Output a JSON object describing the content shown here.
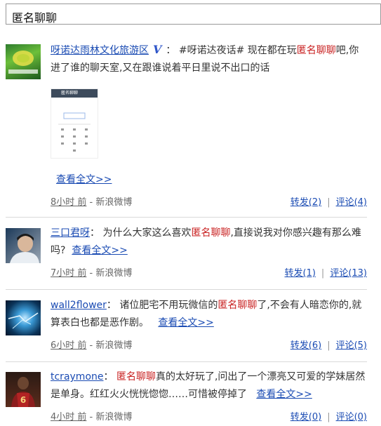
{
  "search": {
    "query": "匿名聊聊"
  },
  "posts": [
    {
      "author": "呀诺达雨林文化旅游区",
      "verified": "V",
      "colon": "：",
      "text_pre": "#呀诺达夜话# 现在都在玩",
      "keyword": "匿名聊聊",
      "text_post": "吧,你进了谁的聊天室,又在跟谁说着平日里说不出口的话",
      "read_more": "查看全文>>",
      "time": "8小时 前",
      "source": "- 新浪微博",
      "repost": "转发(2)",
      "comment": "评论(4)",
      "thumb_title": "匿名聊聊"
    },
    {
      "author": "三口君呀",
      "colon": "：",
      "text_pre": "为什么大家这么喜欢",
      "keyword": "匿名聊聊",
      "text_post": ",直接说我对你感兴趣有那么难吗?",
      "read_more": "查看全文>>",
      "time": "7小时 前",
      "source": "- 新浪微博",
      "repost": "转发(1)",
      "comment": "评论(13)"
    },
    {
      "author": "wall2flower",
      "colon": "：",
      "text_pre": "诸位肥宅不用玩微信的",
      "keyword": "匿名聊聊",
      "text_post": "了,不会有人暗恋你的,就算表白也都是恶作剧。",
      "read_more": "查看全文>>",
      "time": "6小时 前",
      "source": "- 新浪微博",
      "repost": "转发(6)",
      "comment": "评论(5)"
    },
    {
      "author": "tcraymone",
      "colon": "：",
      "text_pre": "",
      "keyword": "匿名聊聊",
      "text_post": "真的太好玩了,问出了一个漂亮又可爱的学妹居然是单身。红红火火恍恍惚惚……可惜被停掉了",
      "read_more": "查看全文>>",
      "time": "4小时 前",
      "source": "- 新浪微博",
      "repost": "转发(0)",
      "comment": "评论(0)"
    }
  ],
  "separator": "|"
}
